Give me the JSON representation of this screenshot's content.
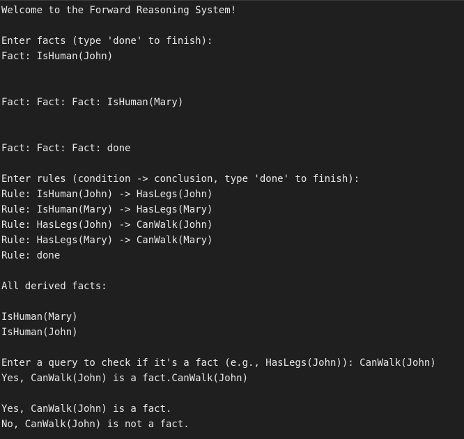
{
  "terminal": {
    "lines": [
      "Welcome to the Forward Reasoning System!",
      "",
      "Enter facts (type 'done' to finish):",
      "Fact: IsHuman(John)",
      "",
      "",
      "Fact: Fact: Fact: IsHuman(Mary)",
      "",
      "",
      "Fact: Fact: Fact: done",
      "",
      "Enter rules (condition -> conclusion, type 'done' to finish):",
      "Rule: IsHuman(John) -> HasLegs(John)",
      "Rule: IsHuman(Mary) -> HasLegs(Mary)",
      "Rule: HasLegs(John) -> CanWalk(John)",
      "Rule: HasLegs(Mary) -> CanWalk(Mary)",
      "Rule: done",
      "",
      "All derived facts:",
      "",
      "IsHuman(Mary)",
      "IsHuman(John)",
      "",
      "Enter a query to check if it's a fact (e.g., HasLegs(John)): CanWalk(John)",
      "Yes, CanWalk(John) is a fact.CanWalk(John)",
      "",
      "Yes, CanWalk(John) is a fact.",
      "No, CanWalk(John) is not a fact."
    ]
  }
}
